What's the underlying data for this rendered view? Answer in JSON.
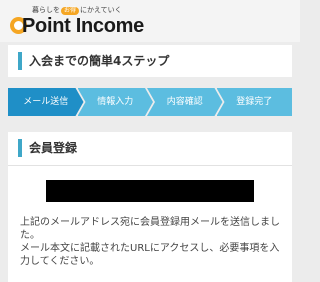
{
  "header": {
    "tagline_before": "暮らしを",
    "tagline_pill": "お得",
    "tagline_after": "にかえていく",
    "logo_text": "Point Income",
    "brand_color": "#f5a623"
  },
  "page": {
    "title": "入会までの簡単4ステップ",
    "accent_color": "#3fa7c8"
  },
  "steps": [
    {
      "label": "メール送信",
      "active": true
    },
    {
      "label": "情報入力",
      "active": false
    },
    {
      "label": "内容確認",
      "active": false
    },
    {
      "label": "登録完了",
      "active": false
    }
  ],
  "registration": {
    "title": "会員登録",
    "message_line1": "上記のメールアドレス宛に会員登録用メールを送信しました。",
    "message_line2": "メール本文に記載されたURLにアクセスし、必要事項を入力してください。"
  }
}
